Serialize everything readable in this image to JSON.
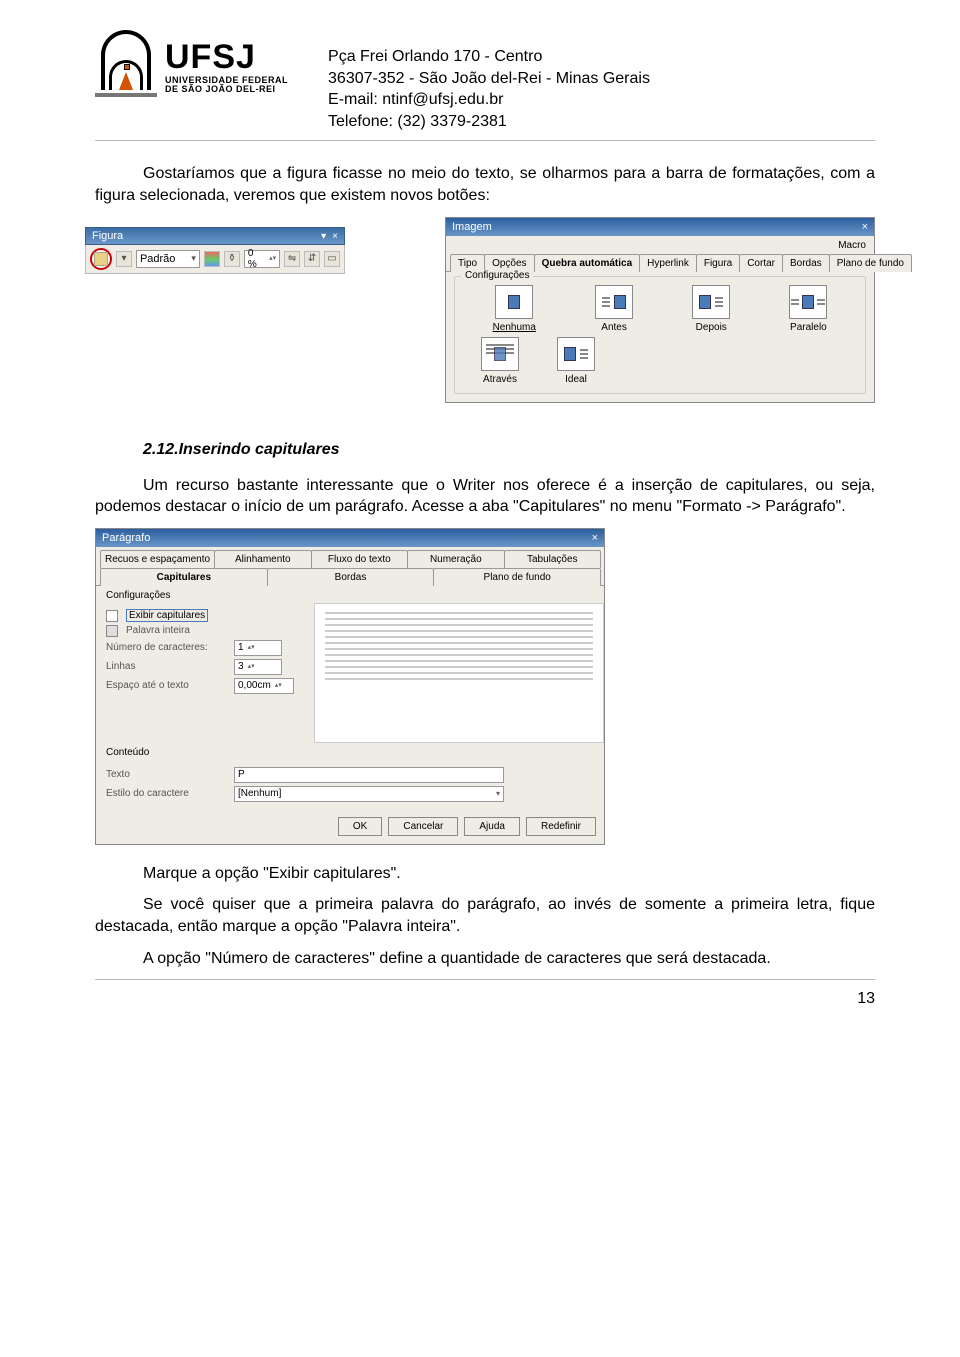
{
  "header": {
    "logo": {
      "name": "UFSJ",
      "sub1": "UNIVERSIDADE FEDERAL",
      "sub2": "DE SÃO JOÃO DEL-REI"
    },
    "contact": {
      "line1": "Pça Frei Orlando 170 - Centro",
      "line2": "36307-352 - São João del-Rei - Minas Gerais",
      "line3": "E-mail: ntinf@ufsj.edu.br",
      "line4": "Telefone: (32) 3379-2381"
    }
  },
  "para1": "Gostaríamos que a figura ficasse no meio do texto, se olharmos para a barra de formatações, com a figura selecionada, veremos que existem novos botões:",
  "figura_toolbar": {
    "title": "Figura",
    "style_value": "Padrão",
    "zoom_value": "0 %"
  },
  "imagem_dialog": {
    "title": "Imagem",
    "macro": "Macro",
    "tabs": [
      "Tipo",
      "Opções",
      "Quebra automática",
      "Hyperlink",
      "Figura",
      "Cortar",
      "Bordas",
      "Plano de fundo"
    ],
    "tab_selected": "Quebra automática",
    "fieldset": "Configurações",
    "wraps": [
      {
        "label": "Nenhuma"
      },
      {
        "label": "Antes"
      },
      {
        "label": "Depois"
      },
      {
        "label": "Paralelo"
      },
      {
        "label": "Através"
      },
      {
        "label": "Ideal"
      }
    ]
  },
  "section_title": "2.12.Inserindo capitulares",
  "para2": "Um recurso bastante interessante que o Writer nos oferece é a inserção de capitulares, ou seja, podemos destacar o início de um parágrafo. Acesse a aba \"Capitulares\" no menu \"Formato -> Parágrafo\".",
  "paragrafo_dialog": {
    "title": "Parágrafo",
    "tabs_row1": [
      "Recuos e espaçamento",
      "Alinhamento",
      "Fluxo do texto",
      "Numeração",
      "Tabulações"
    ],
    "tabs_row2": [
      "Capitulares",
      "Bordas",
      "Plano de fundo"
    ],
    "tab_selected": "Capitulares",
    "group1": "Configurações",
    "row_exibir": "Exibir capitulares",
    "row_palavra": "Palavra inteira",
    "row_numcar": "Número de caracteres:",
    "val_numcar": "1",
    "row_linhas": "Linhas",
    "val_linhas": "3",
    "row_espaco": "Espaço até o texto",
    "val_espaco": "0,00cm",
    "group2": "Conteúdo",
    "row_texto": "Texto",
    "val_texto": "P",
    "row_estilo": "Estilo do caractere",
    "val_estilo": "[Nenhum]",
    "buttons": [
      "OK",
      "Cancelar",
      "Ajuda",
      "Redefinir"
    ]
  },
  "para3": "Marque a opção \"Exibir capitulares\".",
  "para4": "Se você quiser que a primeira palavra do parágrafo, ao invés de somente a primeira letra, fique destacada, então marque a opção \"Palavra inteira\".",
  "para5": "A opção \"Número de caracteres\" define a quantidade de caracteres que será destacada.",
  "page_number": "13"
}
